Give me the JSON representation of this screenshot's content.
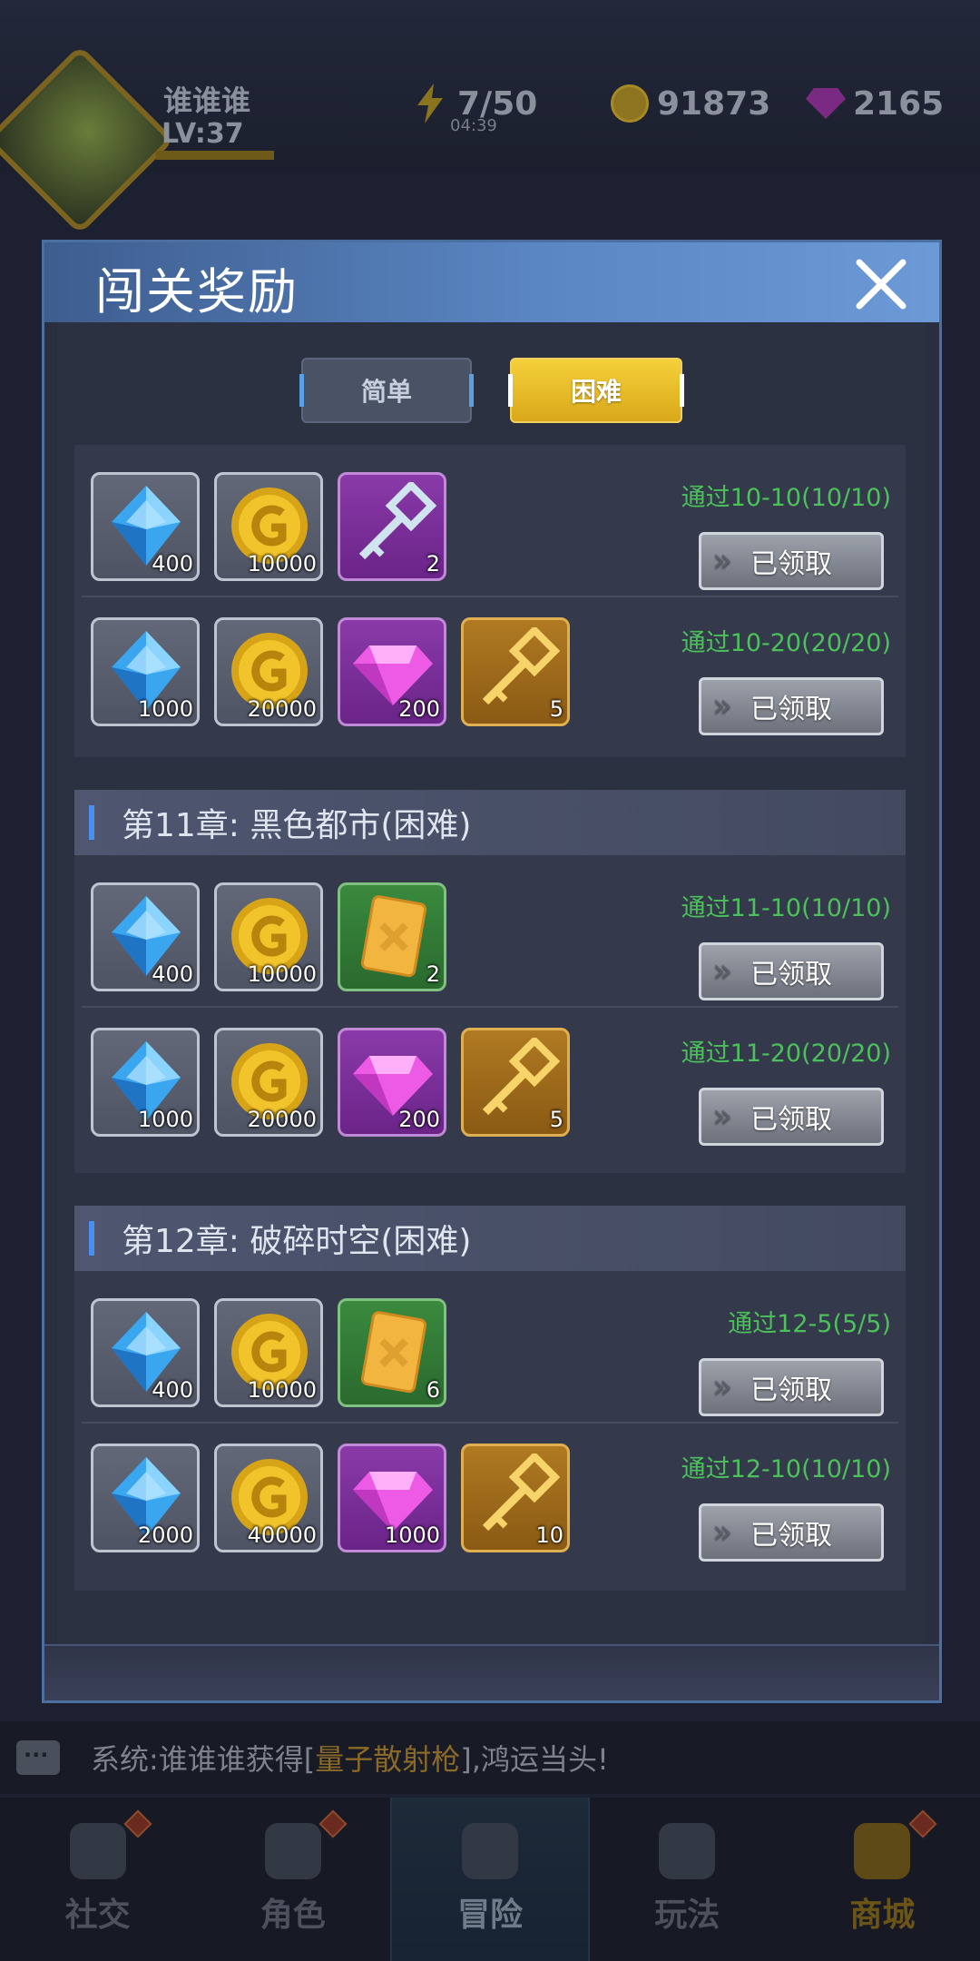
{
  "player": {
    "name": "谁谁谁",
    "level": "LV:37"
  },
  "resources": {
    "energy": "7/50",
    "energy_timer": "04:39",
    "gold": "91873",
    "gems": "2165"
  },
  "dialog": {
    "title": "闯关奖励",
    "tabs": [
      {
        "label": "简单",
        "selected": false
      },
      {
        "label": "困难",
        "selected": true
      }
    ],
    "chapters": [
      {
        "title": "",
        "rows": [
          {
            "requirement": "通过10-10(10/10)",
            "button": "已领取",
            "items": [
              {
                "icon": "blue-crystal-icon",
                "qty": "400"
              },
              {
                "icon": "gold-coin-icon",
                "qty": "10000"
              },
              {
                "icon": "silver-key-icon",
                "qty": "2"
              }
            ]
          },
          {
            "requirement": "通过10-20(20/20)",
            "button": "已领取",
            "items": [
              {
                "icon": "blue-crystal-icon",
                "qty": "1000"
              },
              {
                "icon": "gold-coin-icon",
                "qty": "20000"
              },
              {
                "icon": "purple-gem-icon",
                "qty": "200"
              },
              {
                "icon": "gold-key-icon",
                "qty": "5"
              }
            ]
          }
        ]
      },
      {
        "title": "第11章: 黑色都市(困难)",
        "rows": [
          {
            "requirement": "通过11-10(10/10)",
            "button": "已领取",
            "items": [
              {
                "icon": "blue-crystal-icon",
                "qty": "400"
              },
              {
                "icon": "gold-coin-icon",
                "qty": "10000"
              },
              {
                "icon": "card-icon",
                "qty": "2"
              }
            ]
          },
          {
            "requirement": "通过11-20(20/20)",
            "button": "已领取",
            "items": [
              {
                "icon": "blue-crystal-icon",
                "qty": "1000"
              },
              {
                "icon": "gold-coin-icon",
                "qty": "20000"
              },
              {
                "icon": "purple-gem-icon",
                "qty": "200"
              },
              {
                "icon": "gold-key-icon",
                "qty": "5"
              }
            ]
          }
        ]
      },
      {
        "title": "第12章: 破碎时空(困难)",
        "rows": [
          {
            "requirement": "通过12-5(5/5)",
            "button": "已领取",
            "items": [
              {
                "icon": "blue-crystal-icon",
                "qty": "400"
              },
              {
                "icon": "gold-coin-icon",
                "qty": "10000"
              },
              {
                "icon": "card-icon",
                "qty": "6"
              }
            ]
          },
          {
            "requirement": "通过12-10(10/10)",
            "button": "已领取",
            "items": [
              {
                "icon": "blue-crystal-icon",
                "qty": "2000"
              },
              {
                "icon": "gold-coin-icon",
                "qty": "40000"
              },
              {
                "icon": "purple-gem-icon",
                "qty": "1000"
              },
              {
                "icon": "gold-key-icon",
                "qty": "10"
              }
            ]
          }
        ]
      }
    ]
  },
  "chat": {
    "prefix": "系统:谁谁谁获得[",
    "highlight": "量子散射枪",
    "suffix": "],鸿运当头!"
  },
  "nav": [
    {
      "label": "社交",
      "icon": "social-icon"
    },
    {
      "label": "角色",
      "icon": "character-icon"
    },
    {
      "label": "冒险",
      "icon": "map-pin-icon"
    },
    {
      "label": "玩法",
      "icon": "gamepad-icon"
    },
    {
      "label": "商城",
      "icon": "cart-icon"
    }
  ],
  "colors": {
    "accent_blue": "#5a86c2",
    "tab_selected": "#e8bc28",
    "requirement_green": "#4cc05a"
  }
}
